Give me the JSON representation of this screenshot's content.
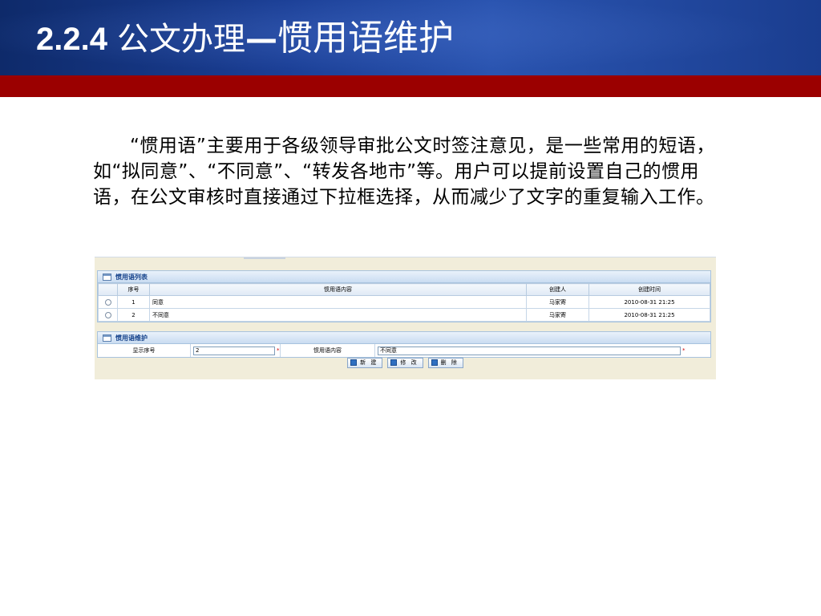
{
  "slide": {
    "section_number": "2.2.4",
    "title_prefix": "公文办理",
    "title_dash": "—",
    "title_main": "惯用语维护",
    "intro": "“惯用语”主要用于各级领导审批公文时签注意见，是一些常用的短语，如“拟同意”、“不同意”、“转发各地市”等。用户可以提前设置自己的惯用语，在公文审核时直接通过下拉框选择，从而减少了文字的重复输入工作。"
  },
  "list_panel": {
    "title": "惯用语列表",
    "columns": [
      "序号",
      "惯用语内容",
      "创建人",
      "创建时间"
    ],
    "rows": [
      {
        "index": "1",
        "content": "同意",
        "creator": "马家寄",
        "created": "2010-08-31 21:25"
      },
      {
        "index": "2",
        "content": "不同意",
        "creator": "马家寄",
        "created": "2010-08-31 21:25"
      }
    ]
  },
  "form_panel": {
    "title": "惯用语维护",
    "order_label": "显示序号",
    "order_value": "2",
    "content_label": "惯用语内容",
    "content_value": "不同意",
    "required_mark": "*"
  },
  "buttons": {
    "new": "新 建",
    "edit": "修 改",
    "delete": "删 除"
  },
  "colors": {
    "header_blue": "#1b3f96",
    "header_red": "#9b0000",
    "panel_title": "#15428b"
  }
}
